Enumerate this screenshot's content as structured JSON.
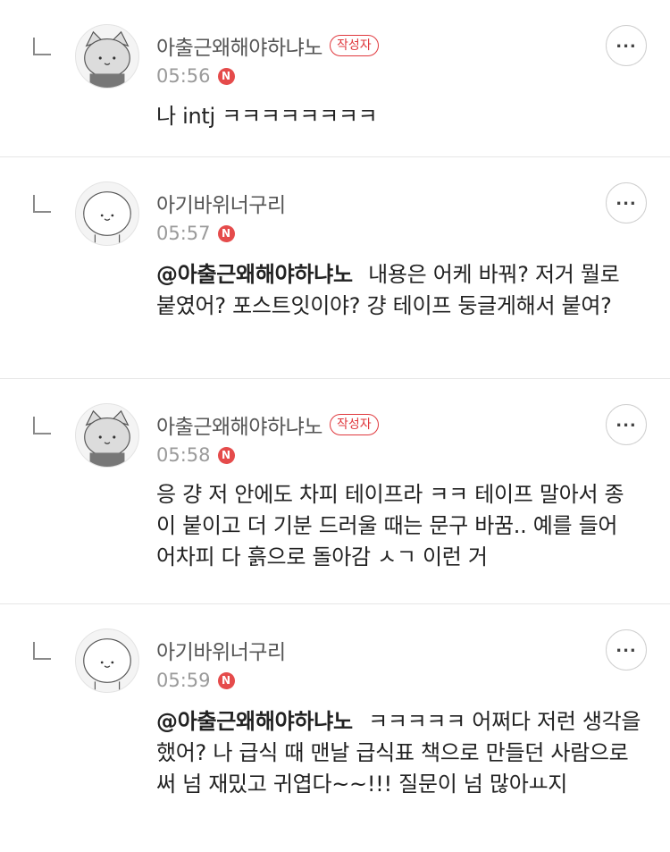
{
  "comments": [
    {
      "author": "아출근왜해야하냐노",
      "is_author": true,
      "author_badge": "작성자",
      "time": "05:56",
      "new_badge": "N",
      "mention": "",
      "text": "나 intj ㅋㅋㅋㅋㅋㅋㅋㅋ",
      "more": "..."
    },
    {
      "author": "아기바위너구리",
      "is_author": false,
      "author_badge": "",
      "time": "05:57",
      "new_badge": "N",
      "mention": "@아출근왜해야하냐노",
      "text": "내용은 어케 바꿔? 저거 뭘로 붙였어? 포스트잇이야? 걍 테이프 둥글게해서 붙여?",
      "more": "..."
    },
    {
      "author": "아출근왜해야하냐노",
      "is_author": true,
      "author_badge": "작성자",
      "time": "05:58",
      "new_badge": "N",
      "mention": "",
      "text": "응 걍 저 안에도 차피 테이프라 ㅋㅋ 테이프 말아서 종이 붙이고 더 기분 드러울 때는 문구 바꿈.. 예를 들어 어차피 다 흙으로 돌아감 ㅅㄱ 이런 거",
      "more": "..."
    },
    {
      "author": "아기바위너구리",
      "is_author": false,
      "author_badge": "",
      "time": "05:59",
      "new_badge": "N",
      "mention": "@아출근왜해야하냐노",
      "text": "ㅋㅋㅋㅋㅋ 어쩌다 저런 생각을했어? 나 급식 때 맨날 급식표 책으로 만들던 사람으로써 넘 재밌고 귀엽다~~!!! 질문이 넘 많아ㅛ지",
      "more": "..."
    }
  ],
  "colors": {
    "accent": "#e0393e",
    "new_badge": "#e54b4b",
    "divider": "#e6e6e6"
  },
  "icons": {
    "reply": "reply-arrow-icon",
    "more": "more-horizontal-icon",
    "avatar_cat": "cat-avatar-icon",
    "avatar_seal": "seal-avatar-icon"
  }
}
